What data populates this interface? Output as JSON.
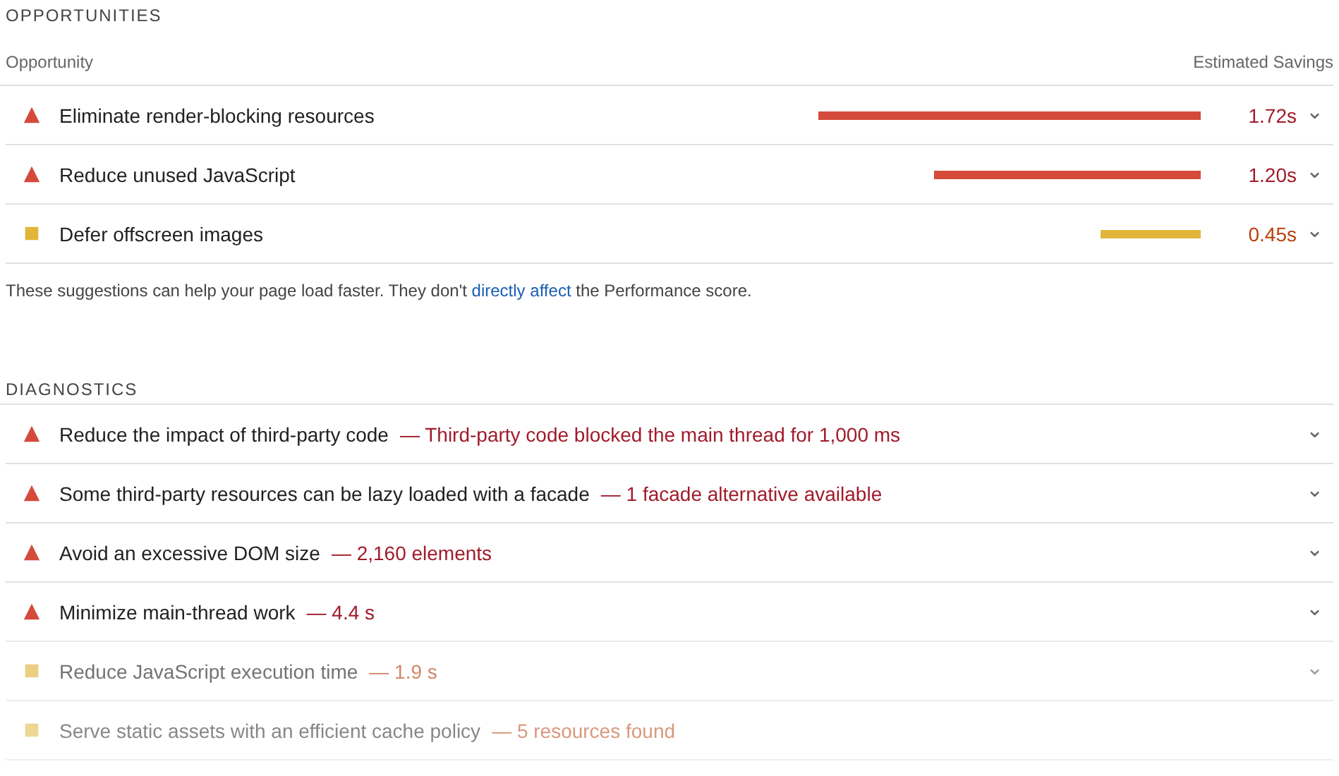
{
  "opportunities": {
    "heading": "OPPORTUNITIES",
    "column_opportunity": "Opportunity",
    "column_savings": "Estimated Savings",
    "rows": [
      {
        "kind": "fail",
        "title": "Eliminate render-blocking resources",
        "savings": "1.72s",
        "expand": "⌄"
      },
      {
        "kind": "fail",
        "title": "Reduce unused JavaScript",
        "savings": "1.20s",
        "expand": "⌄"
      },
      {
        "kind": "average",
        "title": "Defer offscreen images",
        "savings": "0.45s",
        "expand": "⌄"
      }
    ],
    "note": {
      "before": "These suggestions can help your page load faster. They don't ",
      "link": "directly affect",
      "after": " the Performance score."
    }
  },
  "diagnostics": {
    "heading": "DIAGNOSTICS",
    "rows": [
      {
        "kind": "fail",
        "title": "Reduce the impact of third-party code",
        "detail": "— Third-party code blocked the main thread for 1,000 ms",
        "expand": "⌄"
      },
      {
        "kind": "fail",
        "title": "Some third-party resources can be lazy loaded with a facade",
        "detail": "— 1 facade alternative available",
        "expand": "⌄"
      },
      {
        "kind": "fail",
        "title": "Avoid an excessive DOM size",
        "detail": "— 2,160 elements",
        "expand": "⌄"
      },
      {
        "kind": "fail",
        "title": "Minimize main-thread work",
        "detail": "— 4.4 s",
        "expand": "⌄"
      },
      {
        "kind": "average",
        "title": "Reduce JavaScript execution time",
        "detail": "— 1.9 s",
        "expand": "⌄"
      },
      {
        "kind": "average",
        "title": "Serve static assets with an efficient cache policy",
        "detail": "— 5 resources found",
        "expand": ""
      }
    ]
  }
}
